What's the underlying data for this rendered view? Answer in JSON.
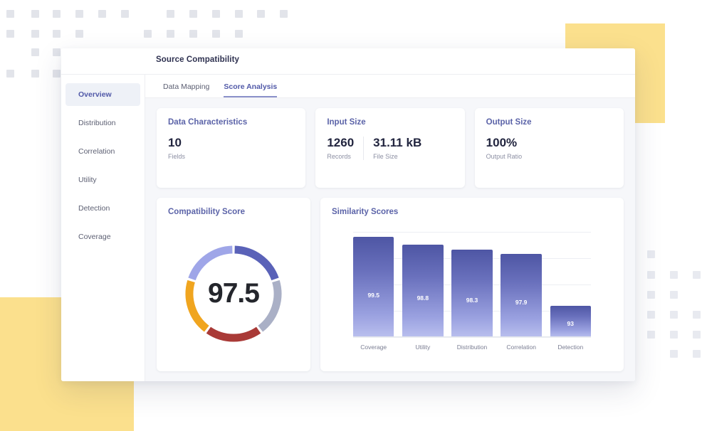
{
  "window": {
    "title": "Source Compatibility"
  },
  "sidebar": {
    "items": [
      {
        "label": "Overview",
        "active": true
      },
      {
        "label": "Distribution",
        "active": false
      },
      {
        "label": "Correlation",
        "active": false
      },
      {
        "label": "Utility",
        "active": false
      },
      {
        "label": "Detection",
        "active": false
      },
      {
        "label": "Coverage",
        "active": false
      }
    ]
  },
  "tabs": [
    {
      "label": "Data Mapping",
      "active": false
    },
    {
      "label": "Score Analysis",
      "active": true
    }
  ],
  "stat_cards": [
    {
      "title": "Data Characteristics",
      "stats": [
        {
          "value": "10",
          "label": "Fields"
        }
      ]
    },
    {
      "title": "Input Size",
      "stats": [
        {
          "value": "1260",
          "label": "Records"
        },
        {
          "value": "31.11 kB",
          "label": "File Size"
        }
      ]
    },
    {
      "title": "Output Size",
      "stats": [
        {
          "value": "100%",
          "label": "Output Ratio"
        }
      ]
    }
  ],
  "score_card": {
    "title": "Compatibility Score",
    "value": "97.5"
  },
  "similarity_card": {
    "title": "Similarity Scores"
  },
  "colors": {
    "accent": "#5159a8",
    "card_title": "#5b63a8",
    "yellow": "#fbe08d",
    "canvas": "#f6f7fa"
  },
  "chart_data": [
    {
      "type": "bar",
      "title": "Similarity Scores",
      "categories": [
        "Coverage",
        "Utility",
        "Distribution",
        "Correlation",
        "Detection"
      ],
      "values": [
        99.5,
        98.8,
        98.3,
        97.9,
        93
      ],
      "xlabel": "",
      "ylabel": "",
      "ylim": [
        90,
        100
      ],
      "grid": true,
      "legend": "none",
      "bar_gradient": [
        "#4e56a4",
        "#b9bfee"
      ]
    },
    {
      "type": "pie",
      "subtype": "donut-gauge",
      "title": "Compatibility Score",
      "center_label": "97.5",
      "segments": [
        {
          "name": "segment-1",
          "value": 20,
          "color": "#5a62b8"
        },
        {
          "name": "segment-2",
          "value": 20,
          "color": "#aab0c6"
        },
        {
          "name": "segment-3",
          "value": 20,
          "color": "#a93a37"
        },
        {
          "name": "segment-4",
          "value": 20,
          "color": "#f0a51f"
        },
        {
          "name": "segment-5",
          "value": 20,
          "color": "#9fa6e8"
        }
      ]
    }
  ]
}
